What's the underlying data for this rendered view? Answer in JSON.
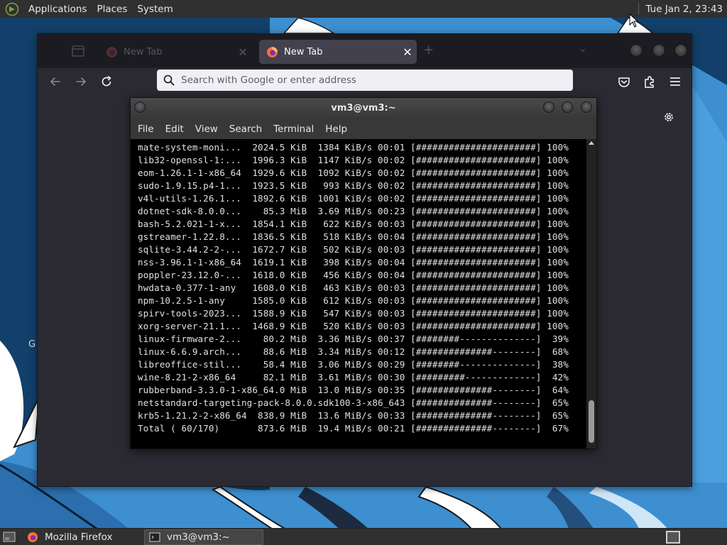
{
  "top_panel": {
    "menus": [
      "Applications",
      "Places",
      "System"
    ],
    "clock": "Tue Jan  2, 23:43"
  },
  "firefox": {
    "tabs": [
      {
        "label": "New Tab",
        "active": false
      },
      {
        "label": "New Tab",
        "active": true
      }
    ],
    "tab_close_glyph": "✕",
    "new_tab_glyph": "+",
    "overflow_glyph": "⌄",
    "urlbar_placeholder": "Search with Google or enter address",
    "partial_text": "G"
  },
  "terminal": {
    "title": "vm3@vm3:~",
    "menus": [
      "File",
      "Edit",
      "View",
      "Search",
      "Terminal",
      "Help"
    ],
    "lines": [
      "mate-system-moni...  2024.5 KiB  1384 KiB/s 00:01 [######################] 100%",
      "lib32-openssl-1:...  1996.3 KiB  1147 KiB/s 00:02 [######################] 100%",
      "eom-1.26.1-1-x86_64  1929.6 KiB  1092 KiB/s 00:02 [######################] 100%",
      "sudo-1.9.15.p4-1...  1923.5 KiB   993 KiB/s 00:02 [######################] 100%",
      "v4l-utils-1.26.1...  1892.6 KiB  1001 KiB/s 00:02 [######################] 100%",
      "dotnet-sdk-8.0.0...    85.3 MiB  3.69 MiB/s 00:23 [######################] 100%",
      "bash-5.2.021-1-x...  1854.1 KiB   622 KiB/s 00:03 [######################] 100%",
      "gstreamer-1.22.8...  1836.5 KiB   518 KiB/s 00:04 [######################] 100%",
      "sqlite-3.44.2-2-...  1672.7 KiB   502 KiB/s 00:03 [######################] 100%",
      "nss-3.96.1-1-x86_64  1619.1 KiB   398 KiB/s 00:04 [######################] 100%",
      "poppler-23.12.0-...  1618.0 KiB   456 KiB/s 00:04 [######################] 100%",
      "hwdata-0.377-1-any   1608.0 KiB   463 KiB/s 00:03 [######################] 100%",
      "npm-10.2.5-1-any     1585.0 KiB   612 KiB/s 00:03 [######################] 100%",
      "spirv-tools-2023...  1588.9 KiB   547 KiB/s 00:03 [######################] 100%",
      "xorg-server-21.1...  1468.9 KiB   520 KiB/s 00:03 [######################] 100%",
      "linux-firmware-2...    80.2 MiB  3.36 MiB/s 00:37 [########--------------]  39%",
      "linux-6.6.9.arch...    88.6 MiB  3.34 MiB/s 00:12 [##############--------]  68%",
      "libreoffice-stil...    58.4 MiB  3.06 MiB/s 00:29 [########--------------]  38%",
      "wine-8.21-2-x86_64     82.1 MiB  3.61 MiB/s 00:30 [#########-------------]  42%",
      "rubberband-3.3.0-1-x86_64.0 MiB  13.0 MiB/s 00:35 [##############--------]  64%",
      "netstandard-targeting-pack-8.0.0.sdk100-3-x86_643 [##############--------]  65%",
      "krb5-1.21.2-2-x86_64  838.9 MiB  13.6 MiB/s 00:33 [##############--------]  65%",
      "Total ( 60/170)       873.6 MiB  19.4 MiB/s 00:21 [##############--------]  67%"
    ]
  },
  "taskbar": {
    "items": [
      {
        "label": "Mozilla Firefox"
      },
      {
        "label": "vm3@vm3:~"
      }
    ]
  },
  "colors": {
    "panel": "#303030",
    "firefox_chrome": "#2b2a33",
    "firefox_tabstrip": "#1c1b22",
    "terminal_bg": "#000000",
    "wallpaper_blue": "#4a9fdc",
    "wallpaper_dark": "#10395f"
  },
  "icons": {
    "menu_logo": "mate-logo-icon",
    "back": "arrow-left-icon",
    "forward": "arrow-right-icon",
    "reload": "reload-icon",
    "search": "search-icon",
    "pocket": "pocket-icon",
    "extensions": "puzzle-icon",
    "menu": "hamburger-menu-icon",
    "settings": "gear-icon"
  }
}
